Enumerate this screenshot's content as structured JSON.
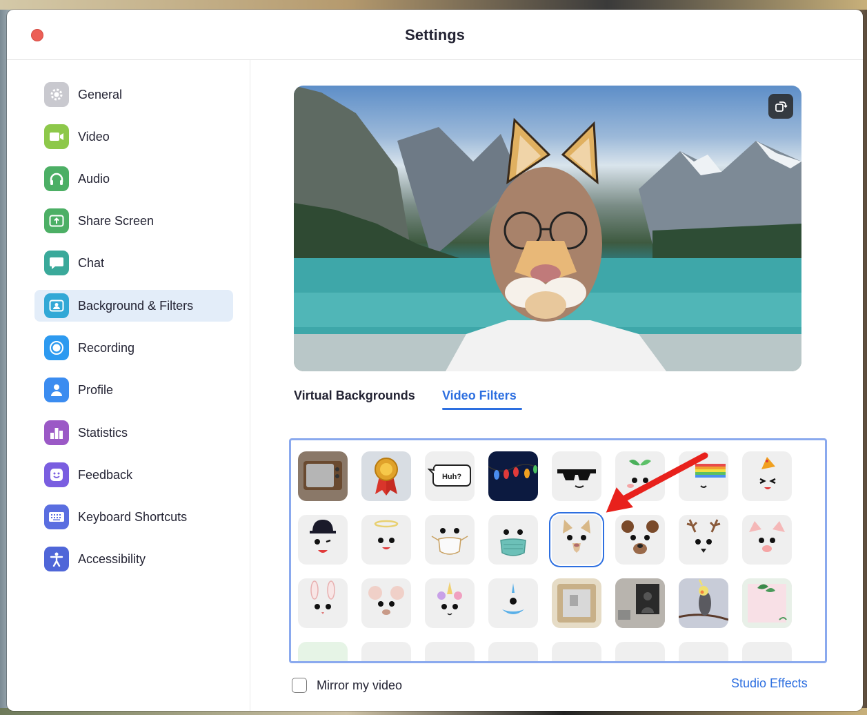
{
  "window": {
    "title": "Settings"
  },
  "sidebar": {
    "items": [
      {
        "label": "General",
        "icon": "gear-icon",
        "color": "#c9c9cf"
      },
      {
        "label": "Video",
        "icon": "video-camera-icon",
        "color": "#8dc84a"
      },
      {
        "label": "Audio",
        "icon": "headphones-icon",
        "color": "#4caf65"
      },
      {
        "label": "Share Screen",
        "icon": "share-screen-icon",
        "color": "#4caf65"
      },
      {
        "label": "Chat",
        "icon": "chat-bubble-icon",
        "color": "#3aa99a"
      },
      {
        "label": "Background & Filters",
        "icon": "person-background-icon",
        "color": "#32a8d6",
        "active": true
      },
      {
        "label": "Recording",
        "icon": "record-icon",
        "color": "#2d9af0"
      },
      {
        "label": "Profile",
        "icon": "profile-icon",
        "color": "#3b8cf0"
      },
      {
        "label": "Statistics",
        "icon": "bar-chart-icon",
        "color": "#9b59c6"
      },
      {
        "label": "Feedback",
        "icon": "smiley-icon",
        "color": "#7a5ee0"
      },
      {
        "label": "Keyboard Shortcuts",
        "icon": "keyboard-icon",
        "color": "#5a6ee0"
      },
      {
        "label": "Accessibility",
        "icon": "accessibility-icon",
        "color": "#4f66d8"
      }
    ]
  },
  "main": {
    "tabs": [
      {
        "label": "Virtual Backgrounds",
        "active": false
      },
      {
        "label": "Video Filters",
        "active": true
      }
    ],
    "filters": [
      {
        "name": "tv-frame",
        "icon": "tv-icon"
      },
      {
        "name": "medal",
        "icon": "medal-icon"
      },
      {
        "name": "speech-bubble",
        "icon": "speech-bubble-icon",
        "text": "Huh?"
      },
      {
        "name": "string-lights",
        "icon": "lights-icon"
      },
      {
        "name": "sunglasses",
        "icon": "sunglasses-icon"
      },
      {
        "name": "sprout",
        "icon": "sprout-icon"
      },
      {
        "name": "rainbow",
        "icon": "rainbow-icon"
      },
      {
        "name": "party-hat",
        "icon": "party-hat-icon"
      },
      {
        "name": "cap",
        "icon": "cap-icon"
      },
      {
        "name": "halo",
        "icon": "halo-icon"
      },
      {
        "name": "face-mask-white",
        "icon": "mask-icon"
      },
      {
        "name": "face-mask-teal",
        "icon": "mask-icon"
      },
      {
        "name": "cat-ears",
        "icon": "cat-icon",
        "selected": true
      },
      {
        "name": "bear",
        "icon": "bear-icon"
      },
      {
        "name": "reindeer",
        "icon": "reindeer-icon"
      },
      {
        "name": "pig",
        "icon": "pig-icon"
      },
      {
        "name": "bunny",
        "icon": "bunny-icon"
      },
      {
        "name": "mouse",
        "icon": "mouse-icon"
      },
      {
        "name": "unicorn",
        "icon": "unicorn-icon"
      },
      {
        "name": "narwhal",
        "icon": "narwhal-icon"
      },
      {
        "name": "picture-frame",
        "icon": "frame-icon"
      },
      {
        "name": "room",
        "icon": "room-icon"
      },
      {
        "name": "cockatiel",
        "icon": "bird-icon"
      },
      {
        "name": "leaf-frame",
        "icon": "leaf-icon"
      }
    ],
    "mirror_label": "Mirror my video",
    "studio_effects_label": "Studio Effects"
  },
  "colors": {
    "accent": "#2d6fe0",
    "selected_nav_bg": "#e3edf9",
    "arrow": "#e8211c"
  }
}
